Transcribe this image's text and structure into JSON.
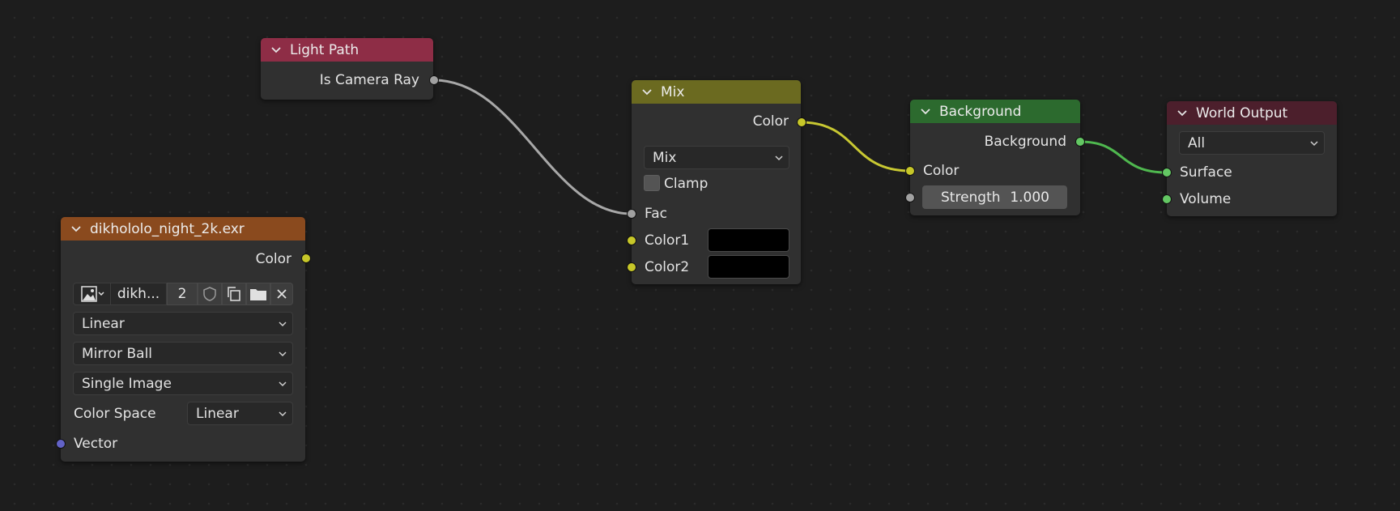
{
  "colors": {
    "light_path_header": "#8e2d46",
    "mix_header": "#6b6a20",
    "background_header": "#2c6a2e",
    "world_output_header": "#4c1f2c",
    "image_header": "#8a4a1e",
    "wire_grey": "#a8a8a8",
    "wire_yellow": "#c8c832",
    "wire_green": "#4fb84f"
  },
  "nodes": {
    "light_path": {
      "title": "Light Path",
      "output_label": "Is Camera Ray"
    },
    "mix": {
      "title": "Mix",
      "output_label": "Color",
      "blend_mode": "Mix",
      "clamp_label": "Clamp",
      "fac_label": "Fac",
      "color1_label": "Color1",
      "color2_label": "Color2"
    },
    "background": {
      "title": "Background",
      "output_label": "Background",
      "color_label": "Color",
      "strength_label": "Strength",
      "strength_value": "1.000"
    },
    "world_output": {
      "title": "World Output",
      "target": "All",
      "surface_label": "Surface",
      "volume_label": "Volume"
    },
    "environment_texture": {
      "title": "dikhololo_night_2k.exr",
      "output_label": "Color",
      "image_name": "dikh...",
      "users_count": "2",
      "interpolation": "Linear",
      "projection": "Mirror Ball",
      "source": "Single Image",
      "color_space_label": "Color Space",
      "color_space": "Linear",
      "vector_label": "Vector"
    }
  }
}
